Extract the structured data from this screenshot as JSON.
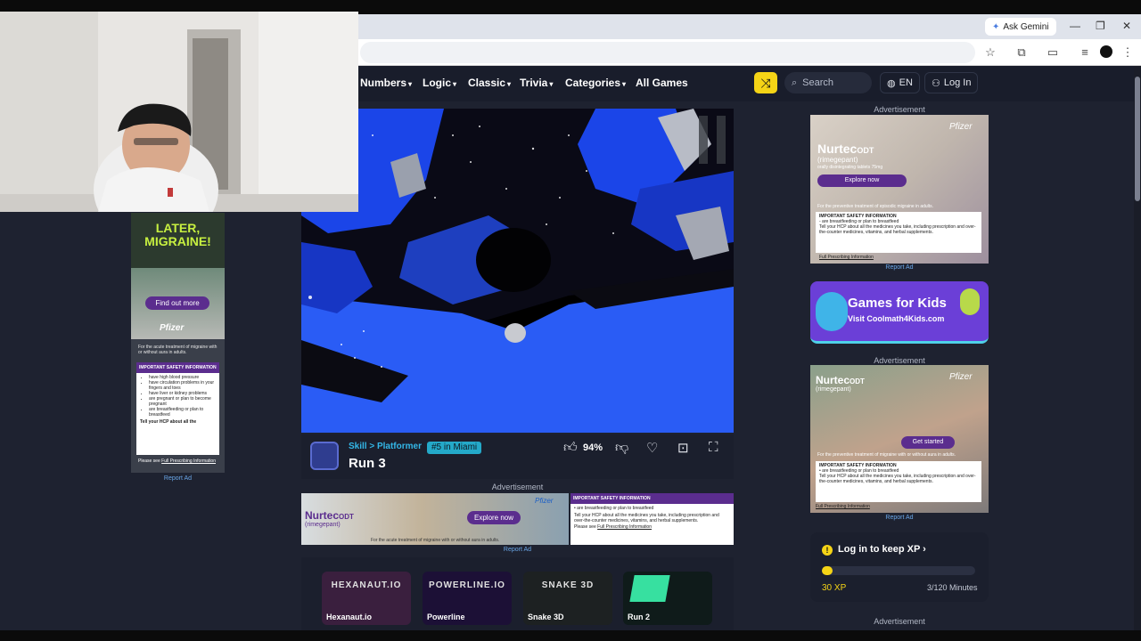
{
  "browser": {
    "ask_gemini": "Ask Gemini"
  },
  "nav": {
    "items": [
      "Numbers",
      "Logic",
      "Classic",
      "Trivia",
      "Categories",
      "All Games"
    ],
    "search_placeholder": "Search",
    "language": "EN",
    "login": "Log In"
  },
  "game": {
    "category": "Skill > Platformer",
    "badge": "#5 in Miami",
    "title": "Run 3",
    "rating": "94%"
  },
  "ads": {
    "advertisement": "Advertisement",
    "report_ad": "Report Ad",
    "right1": {
      "brand": "Nurtec",
      "brand_suffix": "ODT",
      "generic": "(rimegepant)",
      "tagline": "orally disintegrating tablets 75mg",
      "cta": "Explore now",
      "pfizer": "Pfizer",
      "indication": "For the preventive treatment of episodic migraine in adults.",
      "isi_title": "IMPORTANT SAFETY INFORMATION",
      "isi_bullet": "- are breastfeeding or plan to breastfeed",
      "isi_body": "Tell your HCP about all the medicines you take, including prescription and over-the-counter medicines, vitamins, and herbal supplements.",
      "fpi": "Full Prescribing Information"
    },
    "right2": {
      "brand": "Nurtec",
      "brand_suffix": "ODT",
      "generic": "(rimegepant)",
      "cta": "Get started",
      "pfizer": "Pfizer",
      "indication": "For the preventive treatment of migraine with or without aura in adults.",
      "isi_title": "IMPORTANT SAFETY INFORMATION",
      "isi_bullet": "• are breastfeeding or plan to breastfeed",
      "isi_body": "Tell your HCP about all the medicines you take, including prescription and over-the-counter medicines, vitamins, and herbal supplements.",
      "fpi": "Full Prescribing Information"
    },
    "banner": {
      "brand": "Nurtec",
      "brand_suffix": "ODT",
      "generic": "(rimegepant)",
      "cta": "Explore now",
      "pfizer": "Pfizer",
      "indication": "For the acute treatment of migraine with or without aura in adults.",
      "isi_title": "IMPORTANT SAFETY INFORMATION",
      "isi_bullet": "• are breastfeeding or plan to breastfeed",
      "isi_body": "Tell your HCP about all the medicines you take, including prescription and over-the-counter medicines, vitamins, and herbal supplements.",
      "see": "Please see",
      "fpi": "Full Prescribing Information"
    },
    "left": {
      "headline": "LATER, MIGRAINE!",
      "cta": "Find out more",
      "pfizer": "Pfizer",
      "indication": "For the acute treatment of migraine with or without aura in adults.",
      "isi_title": "IMPORTANT SAFETY INFORMATION",
      "bullets": [
        "have high blood pressure",
        "have circulation problems in your fingers and toes",
        "have liver or kidney problems",
        "are pregnant or plan to become pregnant",
        "are breastfeeding or plan to breastfeed"
      ],
      "isi_tail": "Tell your HCP about all the",
      "see": "Please see",
      "fpi": "Full Prescribing Information"
    }
  },
  "kids": {
    "title": "Games for Kids",
    "subtitle": "Visit Coolmath4Kids.com"
  },
  "xp": {
    "title": "Log in to keep XP",
    "xp_value": "30 XP",
    "minutes": "3/120 Minutes",
    "progress": 0.025
  },
  "related_games": [
    {
      "name": "Hexanaut.io",
      "art": "HEXANAUT.IO",
      "bg": "#3a1f3e"
    },
    {
      "name": "Powerline",
      "art": "POWERLINE.IO",
      "bg": "#1c1036"
    },
    {
      "name": "Snake 3D",
      "art": "SNAKE 3D",
      "bg": "#1d2122"
    },
    {
      "name": "Run 2",
      "art": "",
      "bg": "#0f1b1a"
    }
  ],
  "colors": {
    "accent_yellow": "#f5d416",
    "link_blue": "#33b7e8",
    "nurtec_purple": "#5b2d8e"
  }
}
